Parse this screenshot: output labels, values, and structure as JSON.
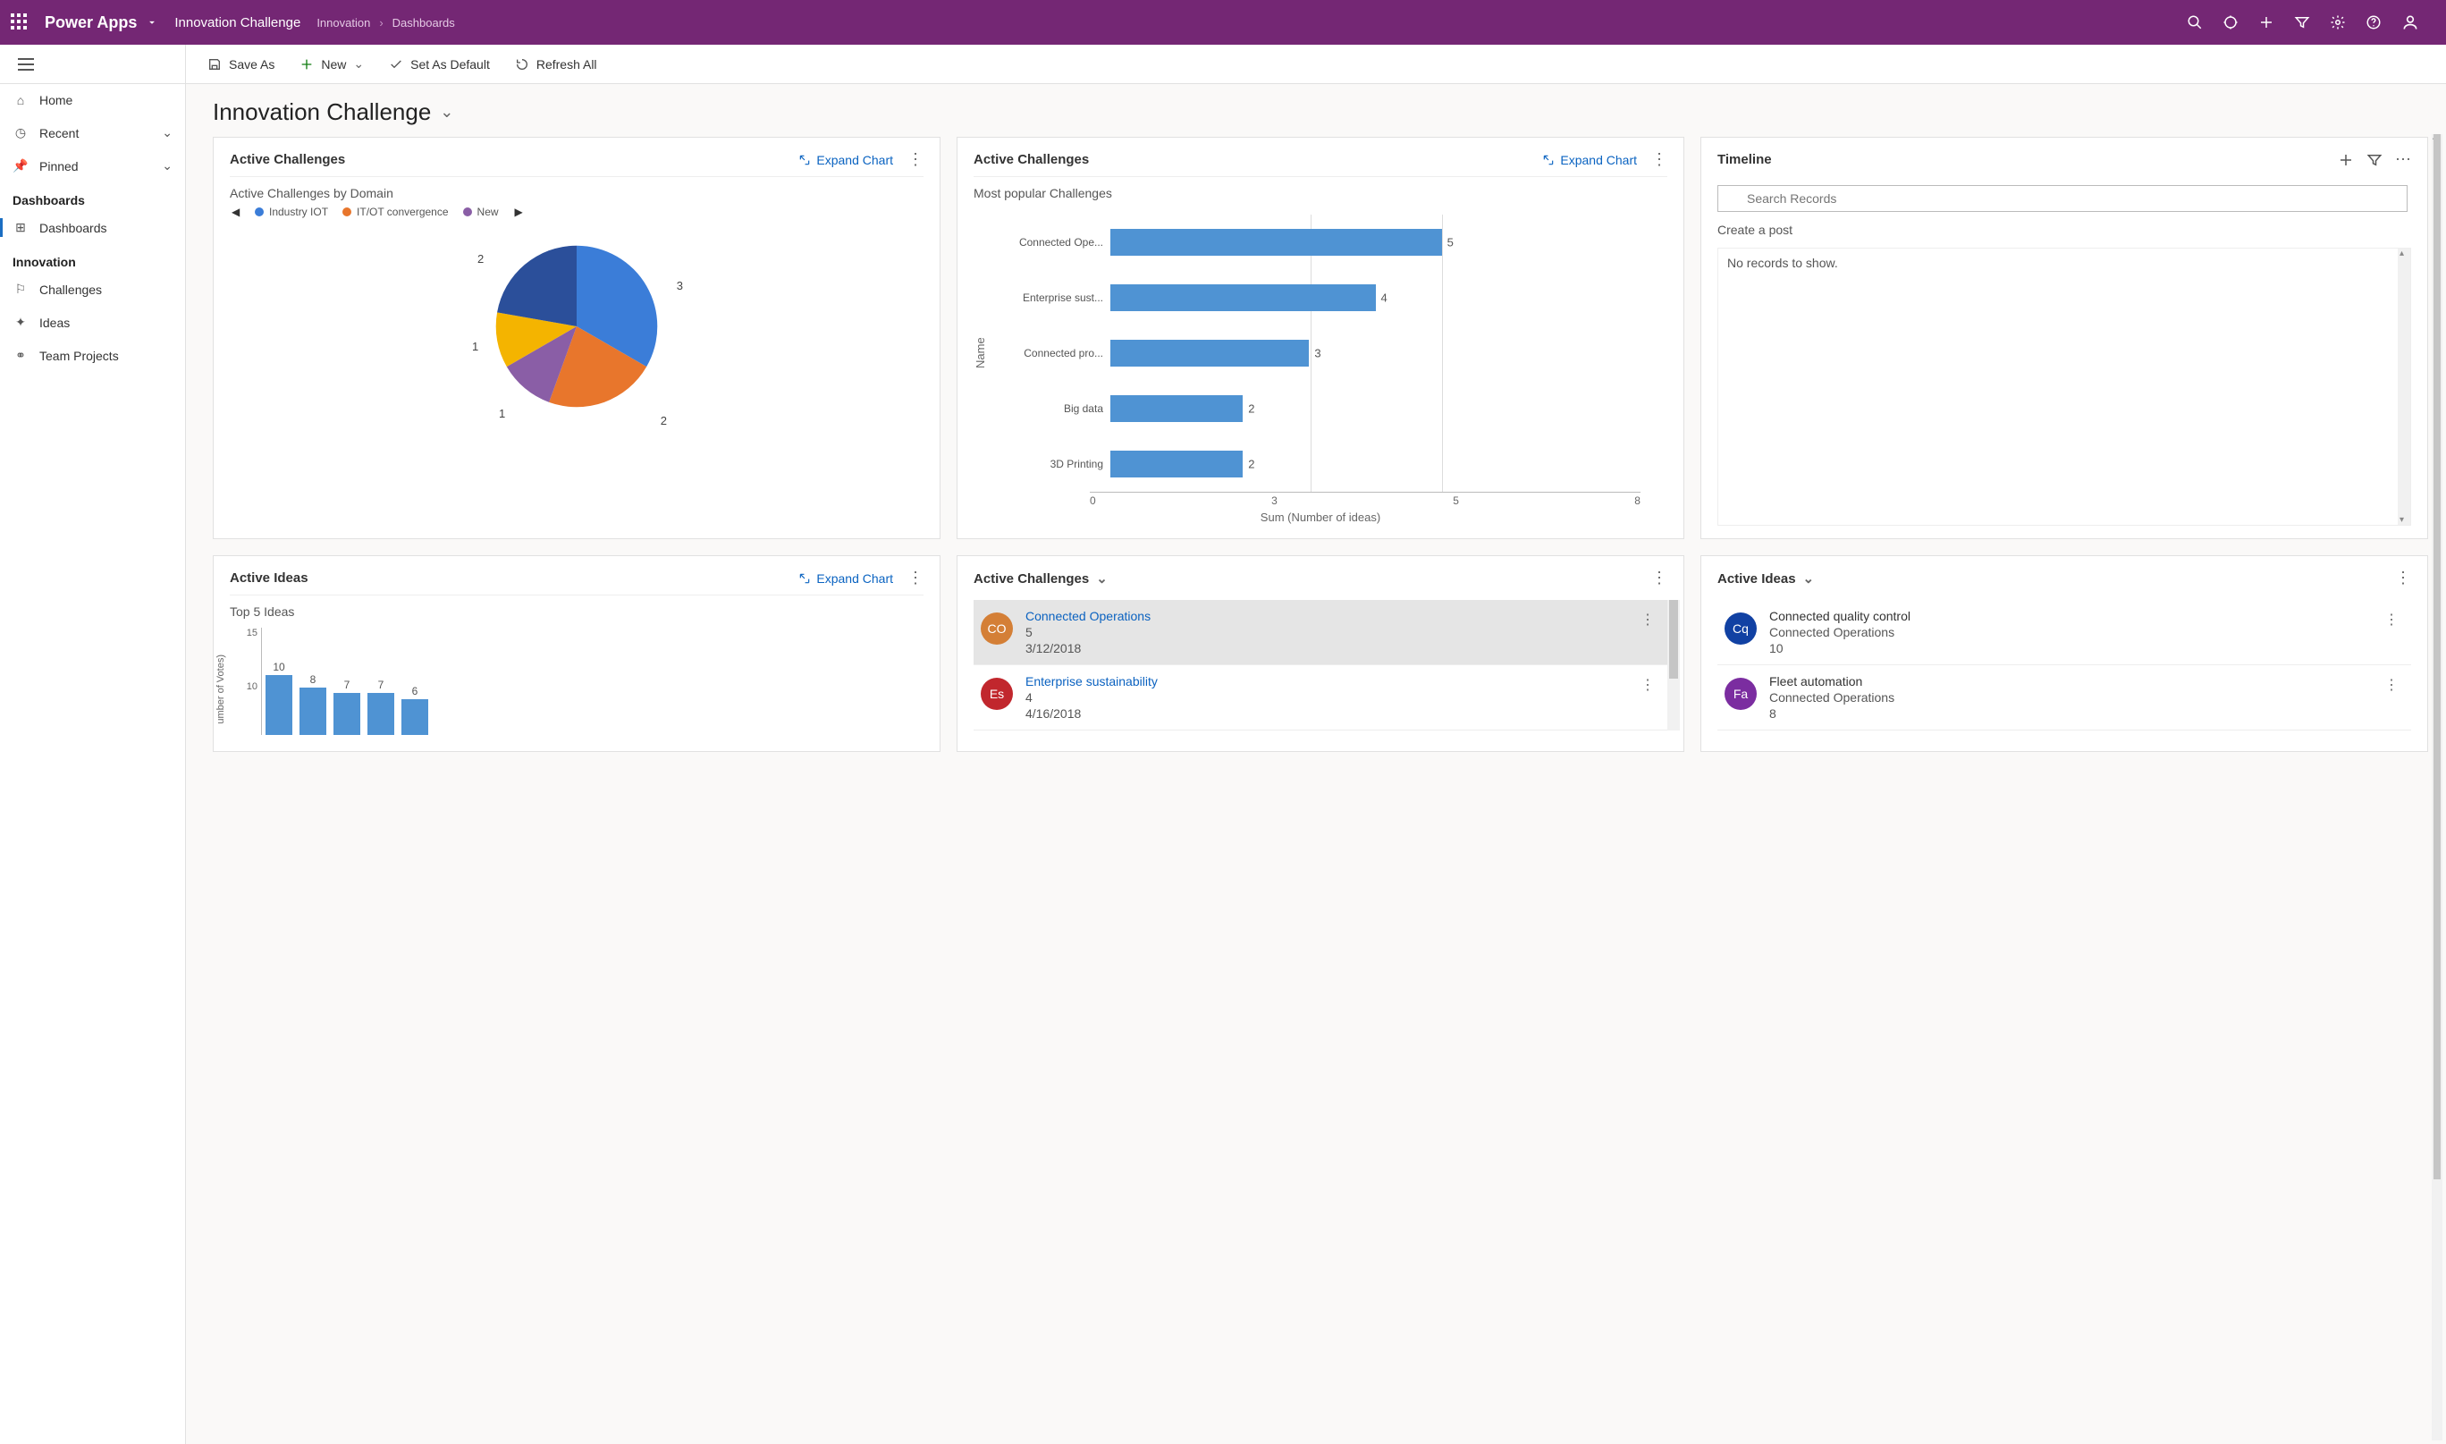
{
  "topbar": {
    "brand": "Power Apps",
    "env": "Innovation Challenge",
    "breadcrumb": [
      "Innovation",
      "Dashboards"
    ]
  },
  "sidebar": {
    "items": [
      {
        "icon": "home",
        "label": "Home"
      },
      {
        "icon": "recent",
        "label": "Recent",
        "chev": true
      },
      {
        "icon": "pin",
        "label": "Pinned",
        "chev": true
      }
    ],
    "group1": {
      "title": "Dashboards",
      "items": [
        {
          "icon": "dashboard",
          "label": "Dashboards",
          "active": true
        }
      ]
    },
    "group2": {
      "title": "Innovation",
      "items": [
        {
          "icon": "trophy",
          "label": "Challenges"
        },
        {
          "icon": "bulb",
          "label": "Ideas"
        },
        {
          "icon": "team",
          "label": "Team Projects"
        }
      ]
    }
  },
  "cmdbar": {
    "saveas": "Save As",
    "new": "New",
    "setdefault": "Set As Default",
    "refresh": "Refresh All"
  },
  "page": {
    "title": "Innovation Challenge"
  },
  "card1": {
    "title": "Active Challenges",
    "expand": "Expand Chart",
    "subtitle": "Active Challenges by Domain",
    "legend": [
      {
        "label": "Industry IOT",
        "color": "#3b7dd8"
      },
      {
        "label": "IT/OT convergence",
        "color": "#e8762c"
      },
      {
        "label": "New",
        "color": "#8a5ea6"
      }
    ]
  },
  "card2": {
    "title": "Active Challenges",
    "expand": "Expand Chart",
    "subtitle": "Most popular Challenges",
    "ylabel": "Name",
    "xlabel": "Sum (Number of ideas)"
  },
  "card3": {
    "title": "Timeline",
    "search_placeholder": "Search Records",
    "create": "Create a post",
    "empty": "No records to show."
  },
  "card4": {
    "title": "Active Ideas",
    "expand": "Expand Chart",
    "subtitle": "Top 5 Ideas",
    "ylab": "umber of Votes)"
  },
  "card5": {
    "title": "Active Challenges",
    "items": [
      {
        "avTxt": "CO",
        "avColor": "#d47f36",
        "title": "Connected Operations",
        "sub1": "5",
        "sub2": "3/12/2018",
        "active": true
      },
      {
        "avTxt": "Es",
        "avColor": "#c1272d",
        "title": "Enterprise sustainability",
        "sub1": "4",
        "sub2": "4/16/2018"
      }
    ]
  },
  "card6": {
    "title": "Active Ideas",
    "items": [
      {
        "avTxt": "Cq",
        "avColor": "#1141a3",
        "title": "Connected quality control",
        "sub1": "Connected Operations",
        "sub2": "10"
      },
      {
        "avTxt": "Fa",
        "avColor": "#7b2da0",
        "title": "Fleet automation",
        "sub1": "Connected Operations",
        "sub2": "8"
      }
    ]
  },
  "chart_data": [
    {
      "type": "pie",
      "title": "Active Challenges by Domain",
      "series": [
        {
          "name": "Industry IOT",
          "value": 3,
          "color": "#3b7dd8"
        },
        {
          "name": "IT/OT convergence",
          "value": 2,
          "color": "#e8762c"
        },
        {
          "name": "New",
          "value": 1,
          "color": "#8a5ea6"
        },
        {
          "name": "(yellow)",
          "value": 1,
          "color": "#f4b400"
        },
        {
          "name": "(dark blue)",
          "value": 2,
          "color": "#2b4f9a"
        }
      ]
    },
    {
      "type": "bar",
      "orientation": "horizontal",
      "title": "Most popular Challenges",
      "ylabel": "Name",
      "xlabel": "Sum (Number of ideas)",
      "xlim": [
        0,
        8
      ],
      "ticks": [
        0,
        3,
        5,
        8
      ],
      "categories": [
        "Connected Ope...",
        "Enterprise sust...",
        "Connected pro...",
        "Big data",
        "3D Printing"
      ],
      "values": [
        5,
        4,
        3,
        2,
        2
      ]
    },
    {
      "type": "bar",
      "orientation": "vertical",
      "title": "Top 5 Ideas",
      "ylabel": "Number of Votes",
      "ylim": [
        0,
        15
      ],
      "ticks": [
        10,
        15
      ],
      "values": [
        10,
        8,
        7,
        7,
        6
      ]
    }
  ]
}
